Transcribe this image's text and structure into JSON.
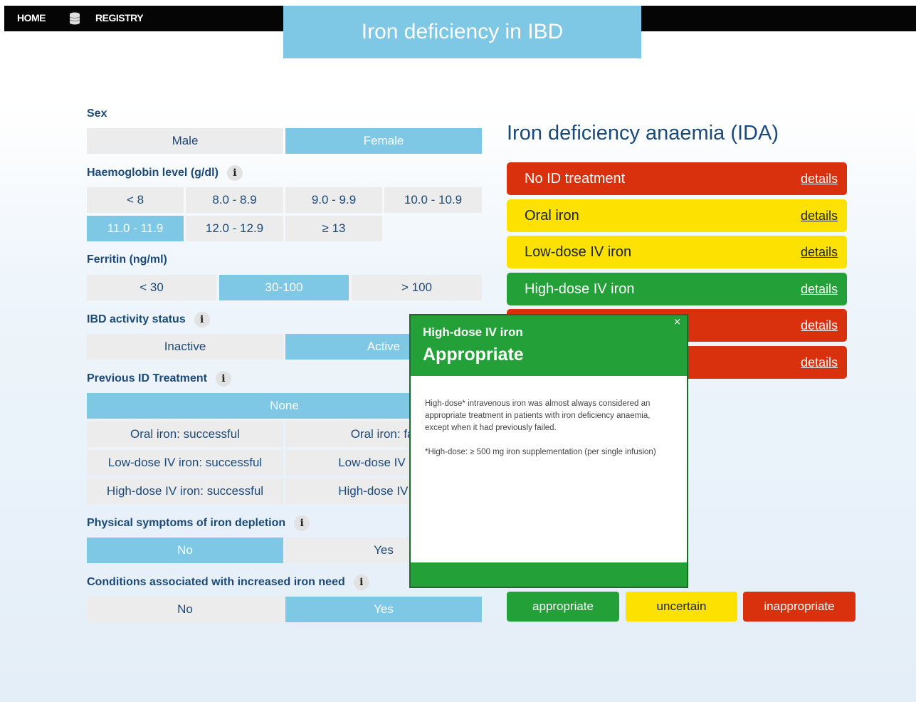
{
  "nav": {
    "home": "HOME",
    "registry": "REGISTRY",
    "title": "Iron deficiency in IBD"
  },
  "form": {
    "sex": {
      "label": "Sex",
      "options": [
        "Male",
        "Female"
      ],
      "selected": "Female"
    },
    "haemoglobin": {
      "label": "Haemoglobin level (g/dl)",
      "options": [
        "< 8",
        "8.0 - 8.9",
        "9.0 - 9.9",
        "10.0 - 10.9",
        "11.0 - 11.9",
        "12.0 - 12.9",
        "≥ 13"
      ],
      "selected": "11.0 - 11.9"
    },
    "ferritin": {
      "label": "Ferritin (ng/ml)",
      "options": [
        "< 30",
        "30-100",
        "> 100"
      ],
      "selected": "30-100"
    },
    "ibd_activity": {
      "label": "IBD activity status",
      "options": [
        "Inactive",
        "Active"
      ],
      "selected": "Active"
    },
    "previous_treatment": {
      "label": "Previous ID Treatment",
      "options": [
        "None",
        "Oral iron: successful",
        "Oral iron: fai",
        "Low-dose IV iron: successful",
        "Low-dose IV iron",
        "High-dose IV iron: successful",
        "High-dose IV iror"
      ],
      "selected": "None"
    },
    "physical_symptoms": {
      "label": "Physical symptoms of iron depletion",
      "options": [
        "No",
        "Yes"
      ],
      "selected": "No"
    },
    "conditions": {
      "label": "Conditions associated with increased iron need",
      "options": [
        "No",
        "Yes"
      ],
      "selected": "Yes"
    }
  },
  "info_symbol": "i",
  "results": {
    "title": "Iron deficiency anaemia (IDA)",
    "details_label": "details",
    "items": [
      {
        "label": "No ID treatment",
        "status": "red"
      },
      {
        "label": "Oral iron",
        "status": "yellow"
      },
      {
        "label": "Low-dose IV iron",
        "status": "yellow"
      },
      {
        "label": "High-dose IV iron",
        "status": "green"
      },
      {
        "label": "",
        "status": "red"
      },
      {
        "label": "",
        "status": "red"
      }
    ]
  },
  "legend": {
    "appropriate": "appropriate",
    "uncertain": "uncertain",
    "inappropriate": "inappropriate"
  },
  "popup": {
    "subtitle": "High-dose IV iron",
    "title": "Appropriate",
    "close": "×",
    "body1": "High-dose* intravenous iron was almost always considered an appropriate treatment in patients with iron deficiency anaemia, except when it had previously failed.",
    "body2": "*High-dose: ≥ 500 mg iron supplementation (per single infusion)"
  },
  "colors": {
    "selected": "#7ec8e6",
    "red": "#d9300d",
    "yellow": "#fde100",
    "green": "#23a037",
    "text": "#1b4a7a"
  }
}
